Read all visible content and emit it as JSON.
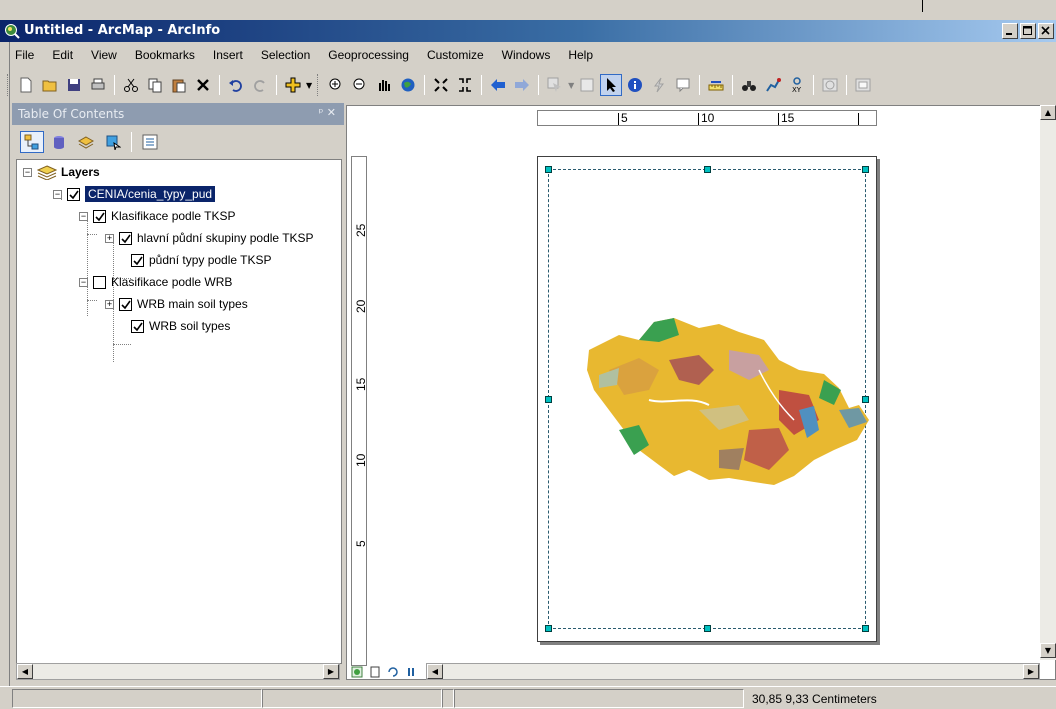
{
  "window": {
    "title": "Untitled - ArcMap - ArcInfo"
  },
  "menu": [
    "File",
    "Edit",
    "View",
    "Bookmarks",
    "Insert",
    "Selection",
    "Geoprocessing",
    "Customize",
    "Windows",
    "Help"
  ],
  "toc": {
    "header": "Table Of Contents",
    "root_label": "Layers",
    "items": [
      {
        "label": "CENIA/cenia_typy_pud",
        "checked": true,
        "selected": true
      },
      {
        "label": "Klasifikace podle TKSP",
        "checked": true
      },
      {
        "label": "hlavní půdní skupiny podle TKSP",
        "checked": true
      },
      {
        "label": "půdní typy podle TKSP",
        "checked": true
      },
      {
        "label": "Klasifikace podle WRB",
        "checked": false
      },
      {
        "label": "WRB main soil types",
        "checked": true
      },
      {
        "label": "WRB soil types",
        "checked": true
      }
    ]
  },
  "ruler": {
    "top_labels": [
      "5",
      "10",
      "15"
    ],
    "left_labels": [
      "25",
      "20",
      "15",
      "10",
      "5"
    ]
  },
  "status": {
    "coordinates": "30,85  9,33 Centimeters"
  },
  "colors": {
    "title_bar": "#0a246a",
    "selection": "#0a246a",
    "map_yellow": "#e8b830",
    "map_green": "#3aa050",
    "map_red": "#c05040",
    "frame_handle": "#00c0c0"
  }
}
